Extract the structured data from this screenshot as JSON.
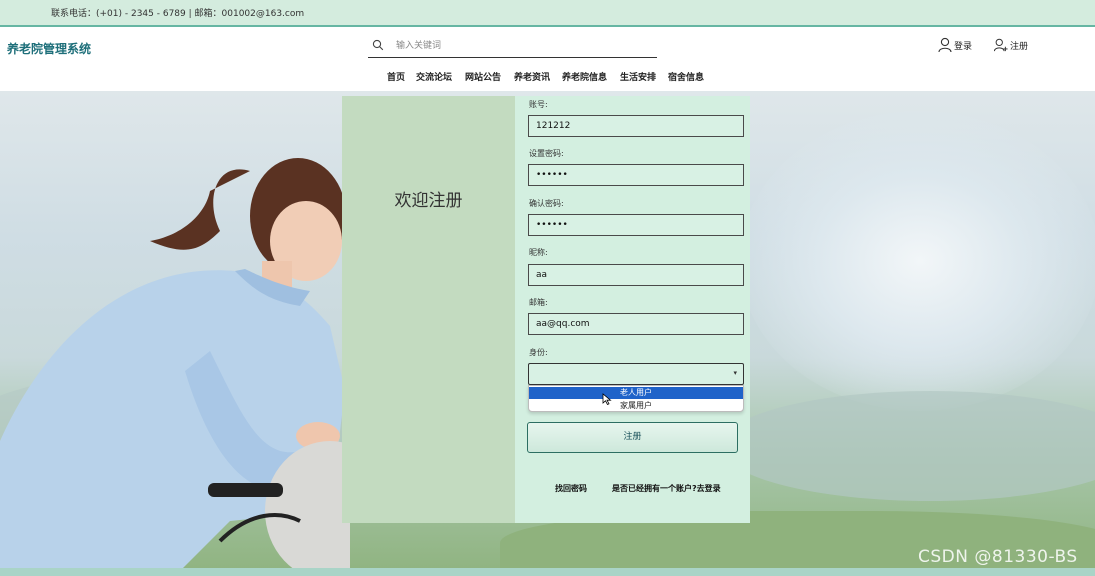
{
  "topbar": {
    "contact": "联系电话：(+01) - 2345 - 6789  |  邮箱：001002@163.com"
  },
  "header": {
    "brand": "养老院管理系统",
    "search_placeholder": "输入关键词",
    "login_label": "登录",
    "register_label": "注册"
  },
  "nav": {
    "items": [
      "首页",
      "交流论坛",
      "网站公告",
      "养老资讯",
      "养老院信息",
      "生活安排",
      "宿舍信息"
    ]
  },
  "card": {
    "welcome": "欢迎注册",
    "fields": [
      {
        "label": "账号:",
        "value": "121212"
      },
      {
        "label": "设置密码:",
        "value": "••••••"
      },
      {
        "label": "确认密码:",
        "value": "••••••"
      },
      {
        "label": "昵称:",
        "value": "aa"
      },
      {
        "label": "邮箱:",
        "value": "aa@qq.com"
      }
    ],
    "identity_label": "身份:",
    "identity_options": [
      "老人用户",
      "家属用户"
    ],
    "identity_highlighted": "老人用户",
    "submit_label": "注册",
    "forgot_link": "找回密码",
    "login_link": "是否已经拥有一个账户?去登录"
  },
  "watermark": "CSDN @81330-BS",
  "colors": {
    "accent": "#1e6f7a",
    "card_left": "#c3dbc0",
    "card_right": "#d3efe0",
    "dropdown_highlight": "#1f63c9"
  }
}
